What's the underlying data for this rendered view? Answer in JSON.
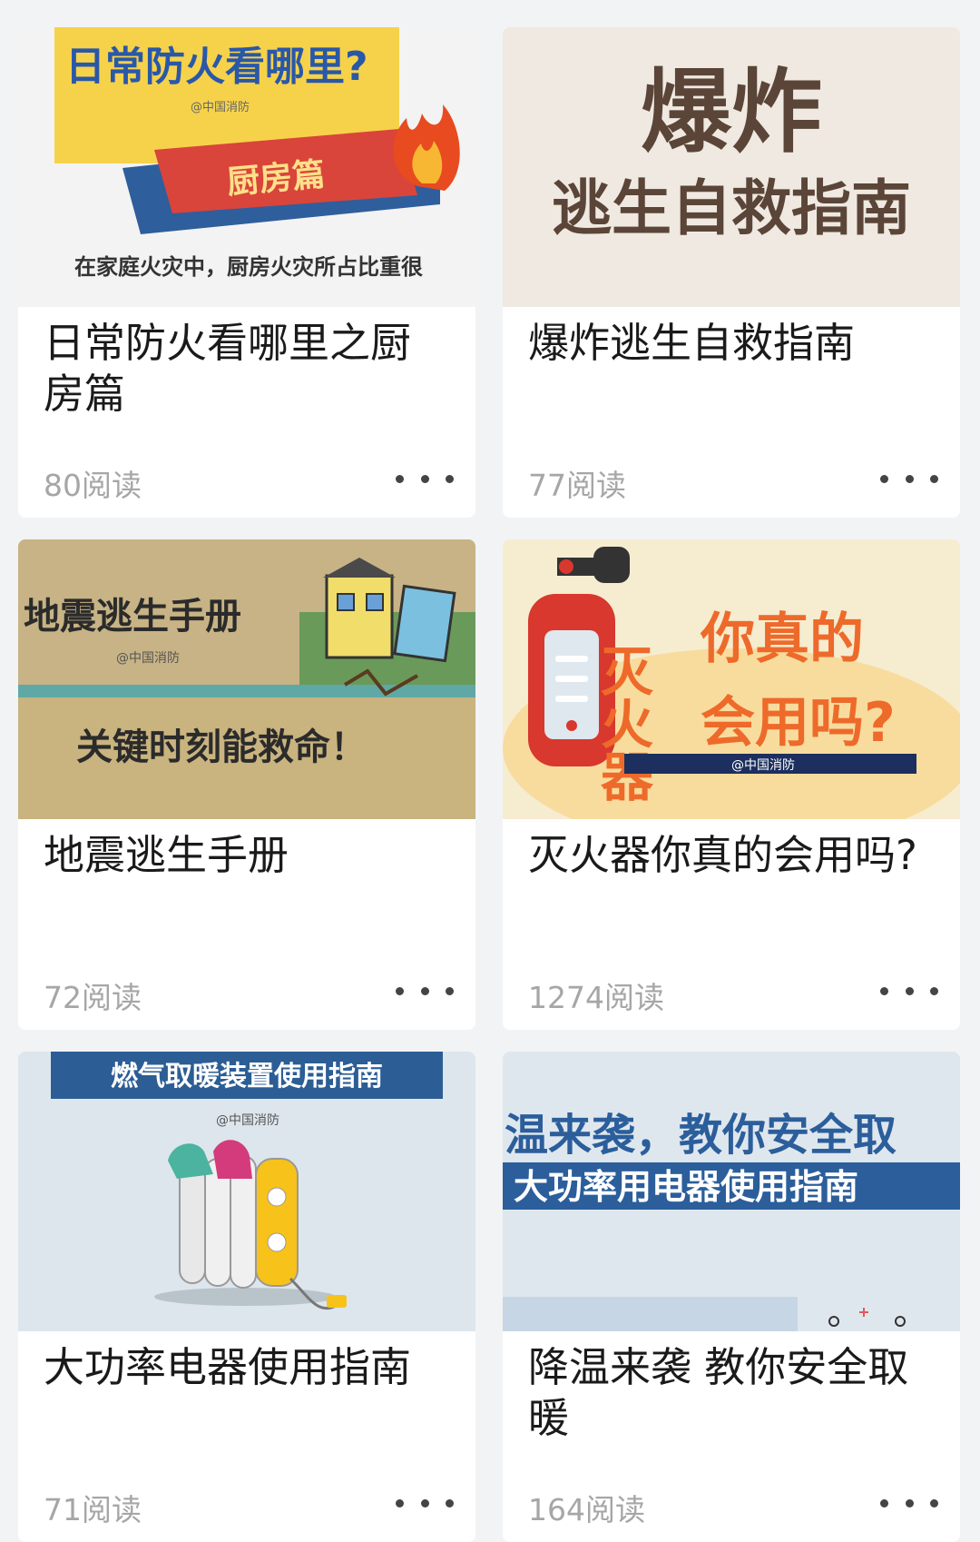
{
  "articles": [
    {
      "title": "日常防火看哪里之厨房篇",
      "reads": "80阅读",
      "thumb": {
        "headline": "日常防火看哪里?",
        "watermark": "@中国消防",
        "ribbon": "厨房篇",
        "caption": "在家庭火灾中，厨房火灾所占比重很"
      }
    },
    {
      "title": "爆炸逃生自救指南",
      "reads": "77阅读",
      "thumb": {
        "headline": "爆炸",
        "subline": "逃生自救指南"
      }
    },
    {
      "title": "地震逃生手册",
      "reads": "72阅读",
      "thumb": {
        "headline": "地震逃生手册",
        "watermark": "@中国消防",
        "subline": "关键时刻能救命！"
      }
    },
    {
      "title": "灭火器你真的会用吗?",
      "reads": "1274阅读",
      "thumb": {
        "vertical": "灭火器",
        "line1": "你真的",
        "line2": "会用吗?",
        "watermark": "@中国消防"
      }
    },
    {
      "title": "大功率电器使用指南",
      "reads": "71阅读",
      "thumb": {
        "banner": "燃气取暖装置使用指南",
        "watermark": "@中国消防"
      }
    },
    {
      "title": "降温来袭 教你安全取暖",
      "reads": "164阅读",
      "thumb": {
        "line1": "温来袭，教你安全取",
        "line2": "大功率用电器使用指南"
      }
    }
  ],
  "more_icon": "more-horizontal-icon"
}
